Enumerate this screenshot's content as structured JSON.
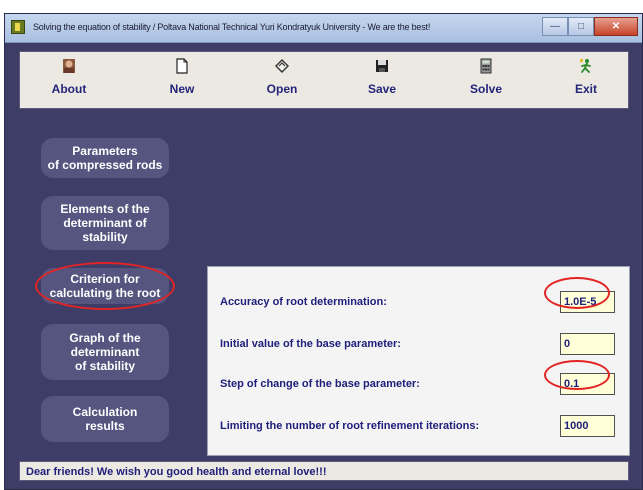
{
  "window": {
    "title": "Solving the equation of stability / Poltava National Technical Yuri Kondratyuk University - We are    the best!"
  },
  "toolbar": {
    "items": [
      {
        "label": "About",
        "icon": "person-icon"
      },
      {
        "label": "New",
        "icon": "new-document-icon"
      },
      {
        "label": "Open",
        "icon": "open-folder-icon"
      },
      {
        "label": "Save",
        "icon": "floppy-disk-icon"
      },
      {
        "label": "Solve",
        "icon": "calculator-icon"
      },
      {
        "label": "Exit",
        "icon": "running-man-icon"
      }
    ]
  },
  "sidebar": {
    "items": [
      {
        "line1": "Parameters",
        "line2": "of compressed rods",
        "line3": ""
      },
      {
        "line1": "Elements of the",
        "line2": "determinant of",
        "line3": "stability"
      },
      {
        "line1": "Criterion for",
        "line2": "calculating the root",
        "line3": ""
      },
      {
        "line1": "Graph of the",
        "line2": "determinant",
        "line3": "of stability"
      },
      {
        "line1": "Calculation",
        "line2": "results",
        "line3": ""
      }
    ]
  },
  "panel": {
    "fields": [
      {
        "label": "Accuracy of root determination:",
        "value": "1.0E-5"
      },
      {
        "label": "Initial value of the base parameter:",
        "value": "0"
      },
      {
        "label": "Step of change of the base parameter:",
        "value": "0.1"
      },
      {
        "label": "Limiting the number of root refinement iterations:",
        "value": "1000"
      }
    ]
  },
  "status_bar": {
    "text": "Dear friends! We wish you good health and eternal love!!!"
  },
  "colors": {
    "background": "#3d3d67",
    "sidebar_button": "#55557f",
    "highlight_circle": "#e32424",
    "input_background": "#ffffd8",
    "label_text": "#20207a"
  }
}
